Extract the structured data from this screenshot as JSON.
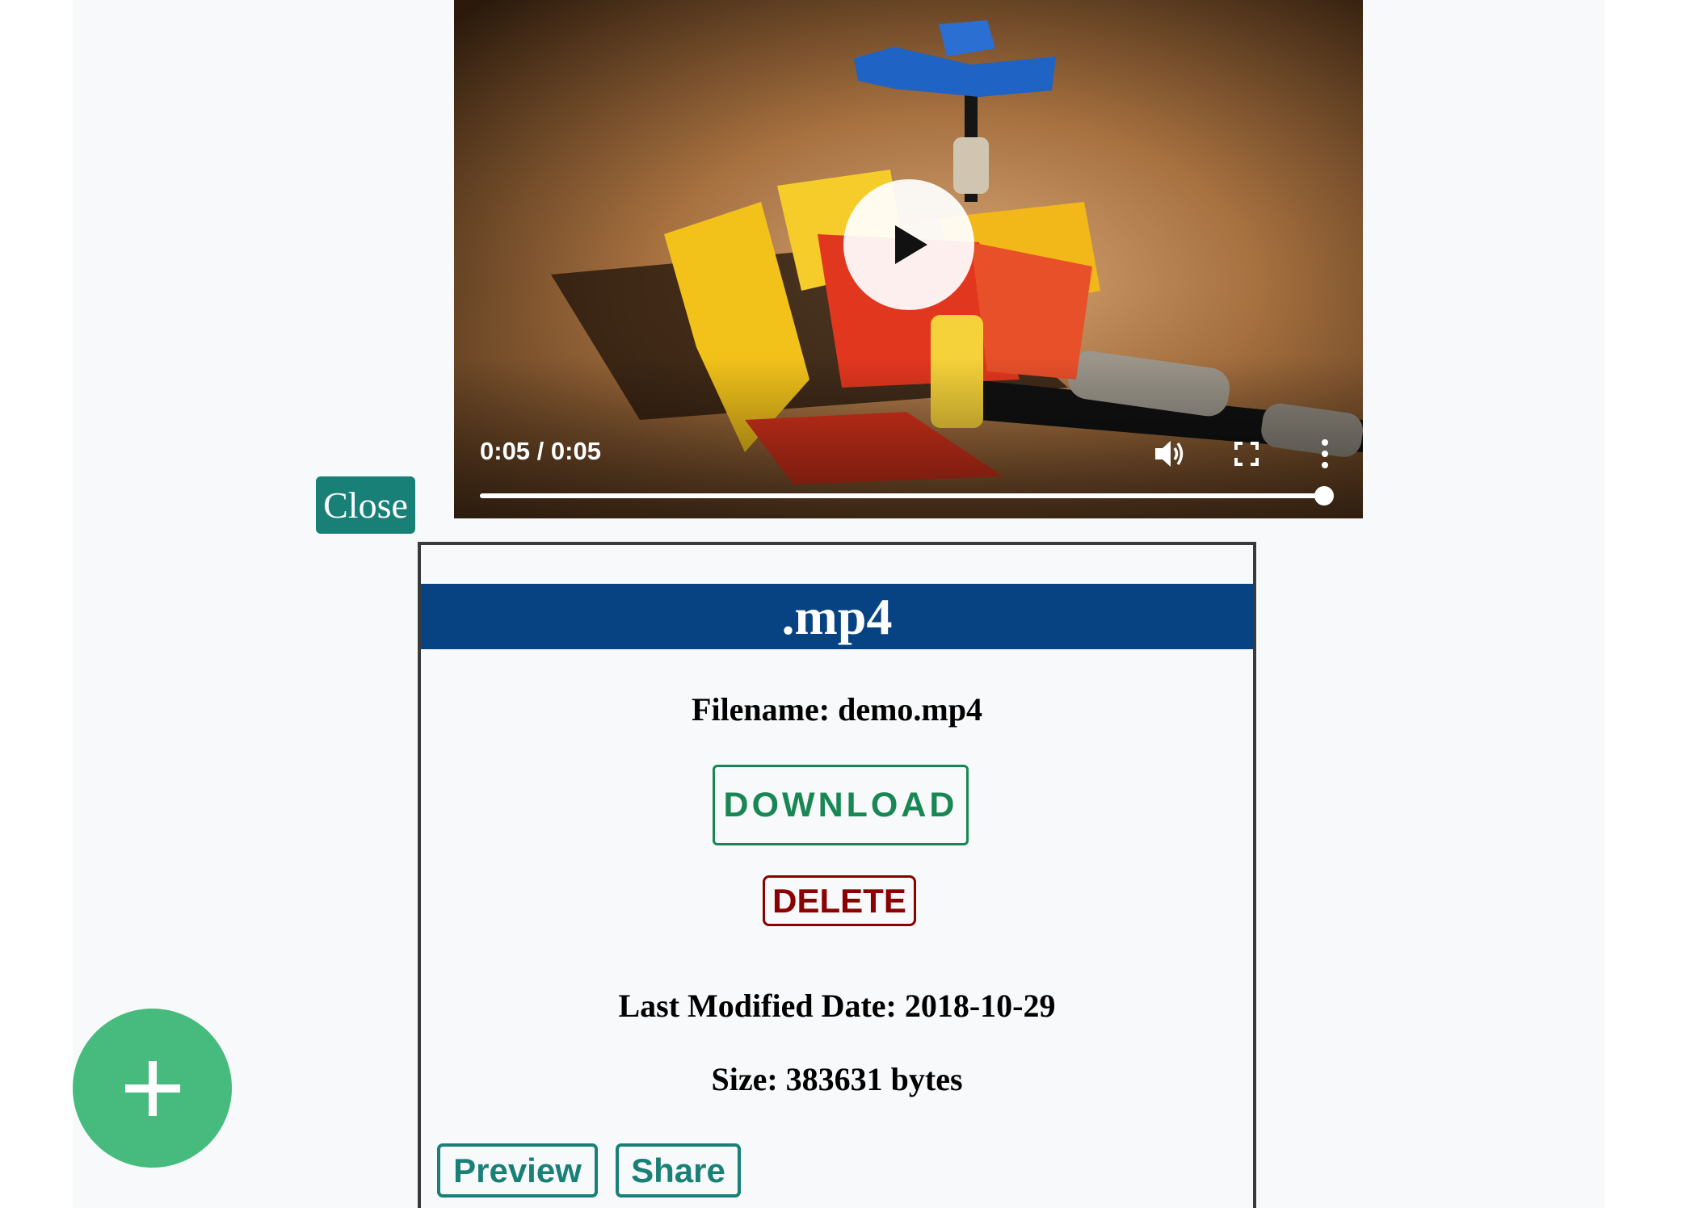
{
  "video": {
    "time": "0:05 / 0:05",
    "progress_fraction": 1.0,
    "icons": {
      "play": "play-icon",
      "volume": "volume-icon",
      "fullscreen": "fullscreen-icon",
      "more": "more-options-icon"
    }
  },
  "close_button": {
    "label": "Close"
  },
  "file_card": {
    "extension": ".mp4",
    "filename": "Filename: demo.mp4",
    "download_label": "DOWNLOAD",
    "delete_label": "DELETE",
    "last_modified": "Last Modified Date: 2018-10-29",
    "size": "Size: 383631 bytes",
    "preview_label": "Preview",
    "share_label": "Share"
  },
  "fab": {
    "icon": "plus-icon"
  },
  "colors": {
    "header_blue": "#074382",
    "teal": "#198077",
    "download_green": "#198754",
    "delete_red": "#8b0000",
    "fab_green": "#47bb7e"
  }
}
